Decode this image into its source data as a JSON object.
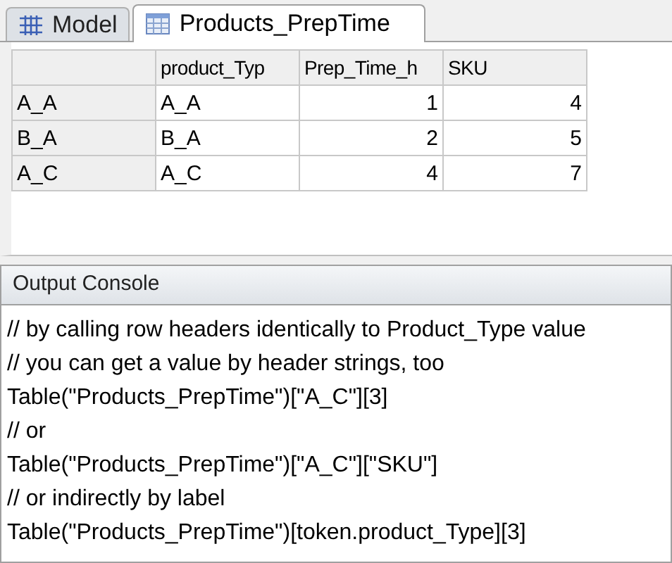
{
  "tabs": [
    {
      "label": "Model",
      "kind": "model",
      "selected": false
    },
    {
      "label": "Products_PrepTime",
      "kind": "table",
      "selected": true
    }
  ],
  "table": {
    "columns": [
      "product_Typ",
      "Prep_Time_h",
      "SKU"
    ],
    "rows": [
      {
        "header": "A_A",
        "cells": [
          "A_A",
          "1",
          "4"
        ]
      },
      {
        "header": "B_A",
        "cells": [
          "B_A",
          "2",
          "5"
        ]
      },
      {
        "header": "A_C",
        "cells": [
          "A_C",
          "4",
          "7"
        ]
      }
    ]
  },
  "console": {
    "title": "Output Console",
    "lines": [
      "// by calling row headers identically to Product_Type value",
      "// you can get a value by header strings, too",
      "Table(\"Products_PrepTime\")[\"A_C\"][3]",
      "// or",
      "Table(\"Products_PrepTime\")[\"A_C\"][\"SKU\"]",
      "// or indirectly by label",
      "Table(\"Products_PrepTime\")[token.product_Type][3]"
    ]
  }
}
